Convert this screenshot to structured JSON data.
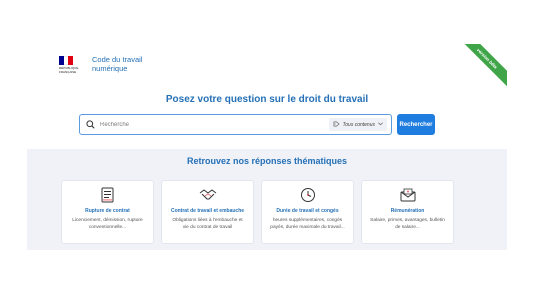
{
  "header": {
    "site_name_line1": "Code du travail",
    "site_name_line2": "numérique",
    "republic_text_line1": "RÉPUBLIQUE",
    "republic_text_line2": "FRANÇAISE",
    "ribbon": "version bêta",
    "flag_colors": [
      "#000091",
      "#ffffff",
      "#e1000f"
    ]
  },
  "hero": {
    "title": "Posez votre question sur le droit du travail"
  },
  "search": {
    "placeholder": "Recherche",
    "filter_label": "Tous contenus",
    "button_label": "Rechercher",
    "icon": "search-icon"
  },
  "themes": {
    "title": "Retrouvez nos réponses thématiques",
    "cards": [
      {
        "icon": "document-icon",
        "title": "Rupture de contrat",
        "desc_line1": "Licenciement, démission, rupture",
        "desc_line2": "conventionnelle..."
      },
      {
        "icon": "handshake-icon",
        "title": "Contrat de travail et embauche",
        "desc_line1": "Obligations liées à l'embauche et",
        "desc_line2": "vie du contrat de travail"
      },
      {
        "icon": "clock-icon",
        "title": "Durée de travail et congés",
        "desc_line1": "heures supplémentaires, congés",
        "desc_line2": "payés, durée maximale du travail..."
      },
      {
        "icon": "money-envelope-icon",
        "title": "Rémunération",
        "desc_line1": "Salaire, primes, avantages, bulletin",
        "desc_line2": "de salaire..."
      }
    ]
  },
  "colors": {
    "accent": "#2570b6",
    "button": "#1f7de0",
    "ribbon": "#3fa548",
    "themes_background": "#f0f2f8"
  }
}
